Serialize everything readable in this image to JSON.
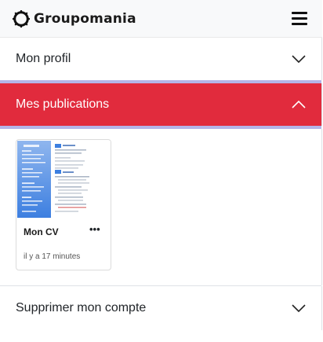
{
  "navbar": {
    "brand": "Groupomania",
    "logo_icon": "globe-outline-icon",
    "menu_icon": "hamburger-menu-icon"
  },
  "sections": {
    "profil": {
      "title": "Mon profil",
      "state": "collapsed"
    },
    "publications": {
      "title": "Mes publications",
      "state": "expanded"
    },
    "supprimer": {
      "title": "Supprimer mon compte",
      "state": "collapsed"
    }
  },
  "publications": [
    {
      "title": "Mon CV",
      "options_label": "•••",
      "time": "il y a 17 minutes"
    }
  ],
  "colors": {
    "active_section": "#e12b3d",
    "separator": "#b5b4e8",
    "navbar_bg": "#f8f9fa"
  }
}
